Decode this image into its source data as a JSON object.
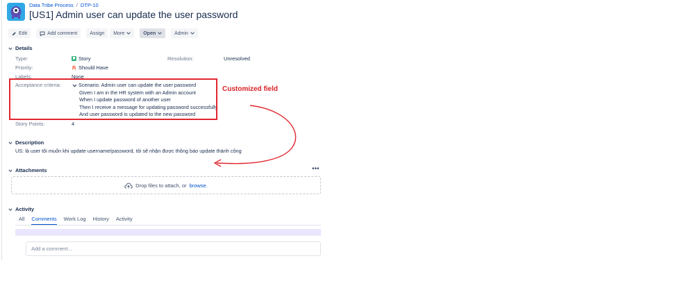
{
  "breadcrumb": {
    "project": "Data Tribe Process",
    "separator": "/",
    "issue_key": "DTP-10"
  },
  "issue": {
    "title": "[US1] Admin user can update the user password"
  },
  "toolbar": {
    "edit": "Edit",
    "add_comment": "Add comment",
    "assign": "Assign",
    "more": "More",
    "status": "Open",
    "admin": "Admin"
  },
  "details": {
    "heading": "Details",
    "type_label": "Type:",
    "type_value": "Story",
    "resolution_label": "Resolution:",
    "resolution_value": "Unresolved",
    "priority_label": "Priority:",
    "priority_value": "Should Have",
    "labels_label": "Labels:",
    "labels_value": "None",
    "acceptance_label": "Acceptance criteria:",
    "acceptance_lines": [
      "Scenario: Admin user can update the user password",
      "Given I am in the HR system with an Admin account",
      "When I update password of another user",
      "Then I receive a message for updating password successfully",
      "And user password is updated to the new password"
    ],
    "story_points_label": "Story Points:",
    "story_points_value": "4"
  },
  "annotation": {
    "text": "Customized field",
    "color": "#d92027"
  },
  "description": {
    "heading": "Description",
    "text": "US: là user tôi muốn khi update username/password, tôi sẽ nhận được thông báo update thành công"
  },
  "attachments": {
    "heading": "Attachments",
    "more": "•••",
    "drop_text": "Drop files to attach, or",
    "browse": "browse."
  },
  "activity": {
    "heading": "Activity",
    "tabs": [
      "All",
      "Comments",
      "Work Log",
      "History",
      "Activity"
    ],
    "active_tab": "Comments",
    "comment_placeholder": "Add a comment..."
  },
  "colors": {
    "link": "#0052cc",
    "annotation_red": "#e0262e",
    "story_green": "#36b37e",
    "avatar_blue": "#2fa8e6"
  },
  "icons": [
    "project-avatar",
    "edit-icon",
    "comment-icon",
    "chevron-down-icon",
    "story-icon",
    "priority-icon",
    "cloud-upload-icon"
  ]
}
